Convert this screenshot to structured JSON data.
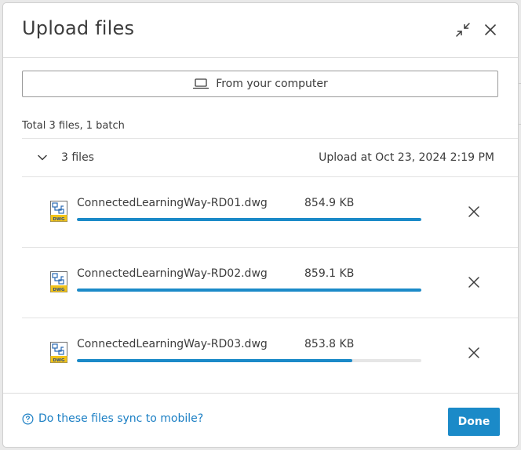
{
  "dialog": {
    "title": "Upload files",
    "from_computer_label": "From your computer",
    "total_text": "Total 3 files, 1 batch"
  },
  "batch": {
    "count_label": "3 files",
    "upload_time": "Upload at Oct 23, 2024 2:19 PM"
  },
  "files": [
    {
      "name": "ConnectedLearningWay-RD01.dwg",
      "size": "854.9 KB",
      "progress_percent": 100,
      "icon_label": "DWG"
    },
    {
      "name": "ConnectedLearningWay-RD02.dwg",
      "size": "859.1 KB",
      "progress_percent": 100,
      "icon_label": "DWG"
    },
    {
      "name": "ConnectedLearningWay-RD03.dwg",
      "size": "853.8 KB",
      "progress_percent": 80,
      "icon_label": "DWG"
    }
  ],
  "footer": {
    "help_link": "Do these files sync to mobile?",
    "done_label": "Done"
  },
  "colors": {
    "accent": "#1b8ac8",
    "link": "#1b7fc4",
    "text": "#3c3c3c"
  },
  "icons": {
    "minimize": "collapse-arrows-icon",
    "close": "close-icon",
    "computer": "laptop-icon",
    "chevron": "chevron-down-icon",
    "file": "dwg-file-icon",
    "remove": "remove-file-icon",
    "help": "help-circle-icon"
  }
}
